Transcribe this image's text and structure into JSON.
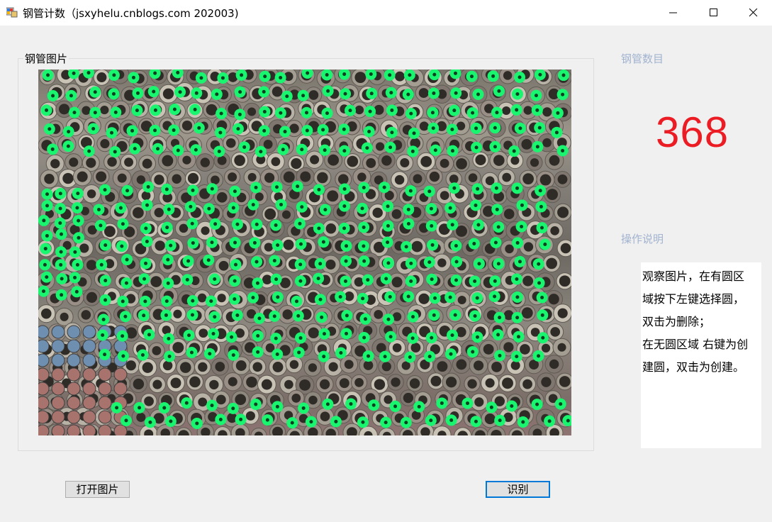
{
  "window": {
    "title": "钢管计数（jsxyhelu.cnblogs.com 202003)"
  },
  "group": {
    "title": "钢管图片"
  },
  "count": {
    "label": "钢管数目",
    "value": "368",
    "color": "#ec1c24"
  },
  "help": {
    "label": "操作说明",
    "lines": [
      "观察图片，在有圆区",
      "域按下左键选择圆，",
      "双击为删除；",
      "在无圆区域 右键为创",
      "建圆，双击为创建。"
    ]
  },
  "buttons": {
    "open": "打开图片",
    "recognize": "识别"
  },
  "colors": {
    "marker_outer": "#19f56e",
    "marker_inner": "#0b3d1f",
    "focus": "#0078d7"
  }
}
